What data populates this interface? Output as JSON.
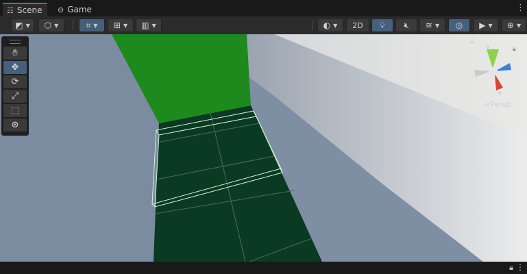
{
  "tabs": [
    {
      "label": "Scene",
      "icon": "grid-icon",
      "active": true
    },
    {
      "label": "Game",
      "icon": "gamepad-icon",
      "active": false
    }
  ],
  "toolbar": {
    "view_2d_label": "2D",
    "accent": "#46607c"
  },
  "tools": [
    "hand-tool",
    "move-tool",
    "rotate-tool",
    "scale-tool",
    "rect-tool",
    "transform-tool"
  ],
  "gizmo": {
    "projection_label": "Persp",
    "axis_colors": {
      "x": "#d9452f",
      "y": "#8fd14f",
      "z": "#3f7fd9"
    }
  },
  "scene": {
    "wall_color": "#1e8a1e",
    "floor_color": "#0b3a22",
    "sky_color": "#7e8ea3"
  }
}
